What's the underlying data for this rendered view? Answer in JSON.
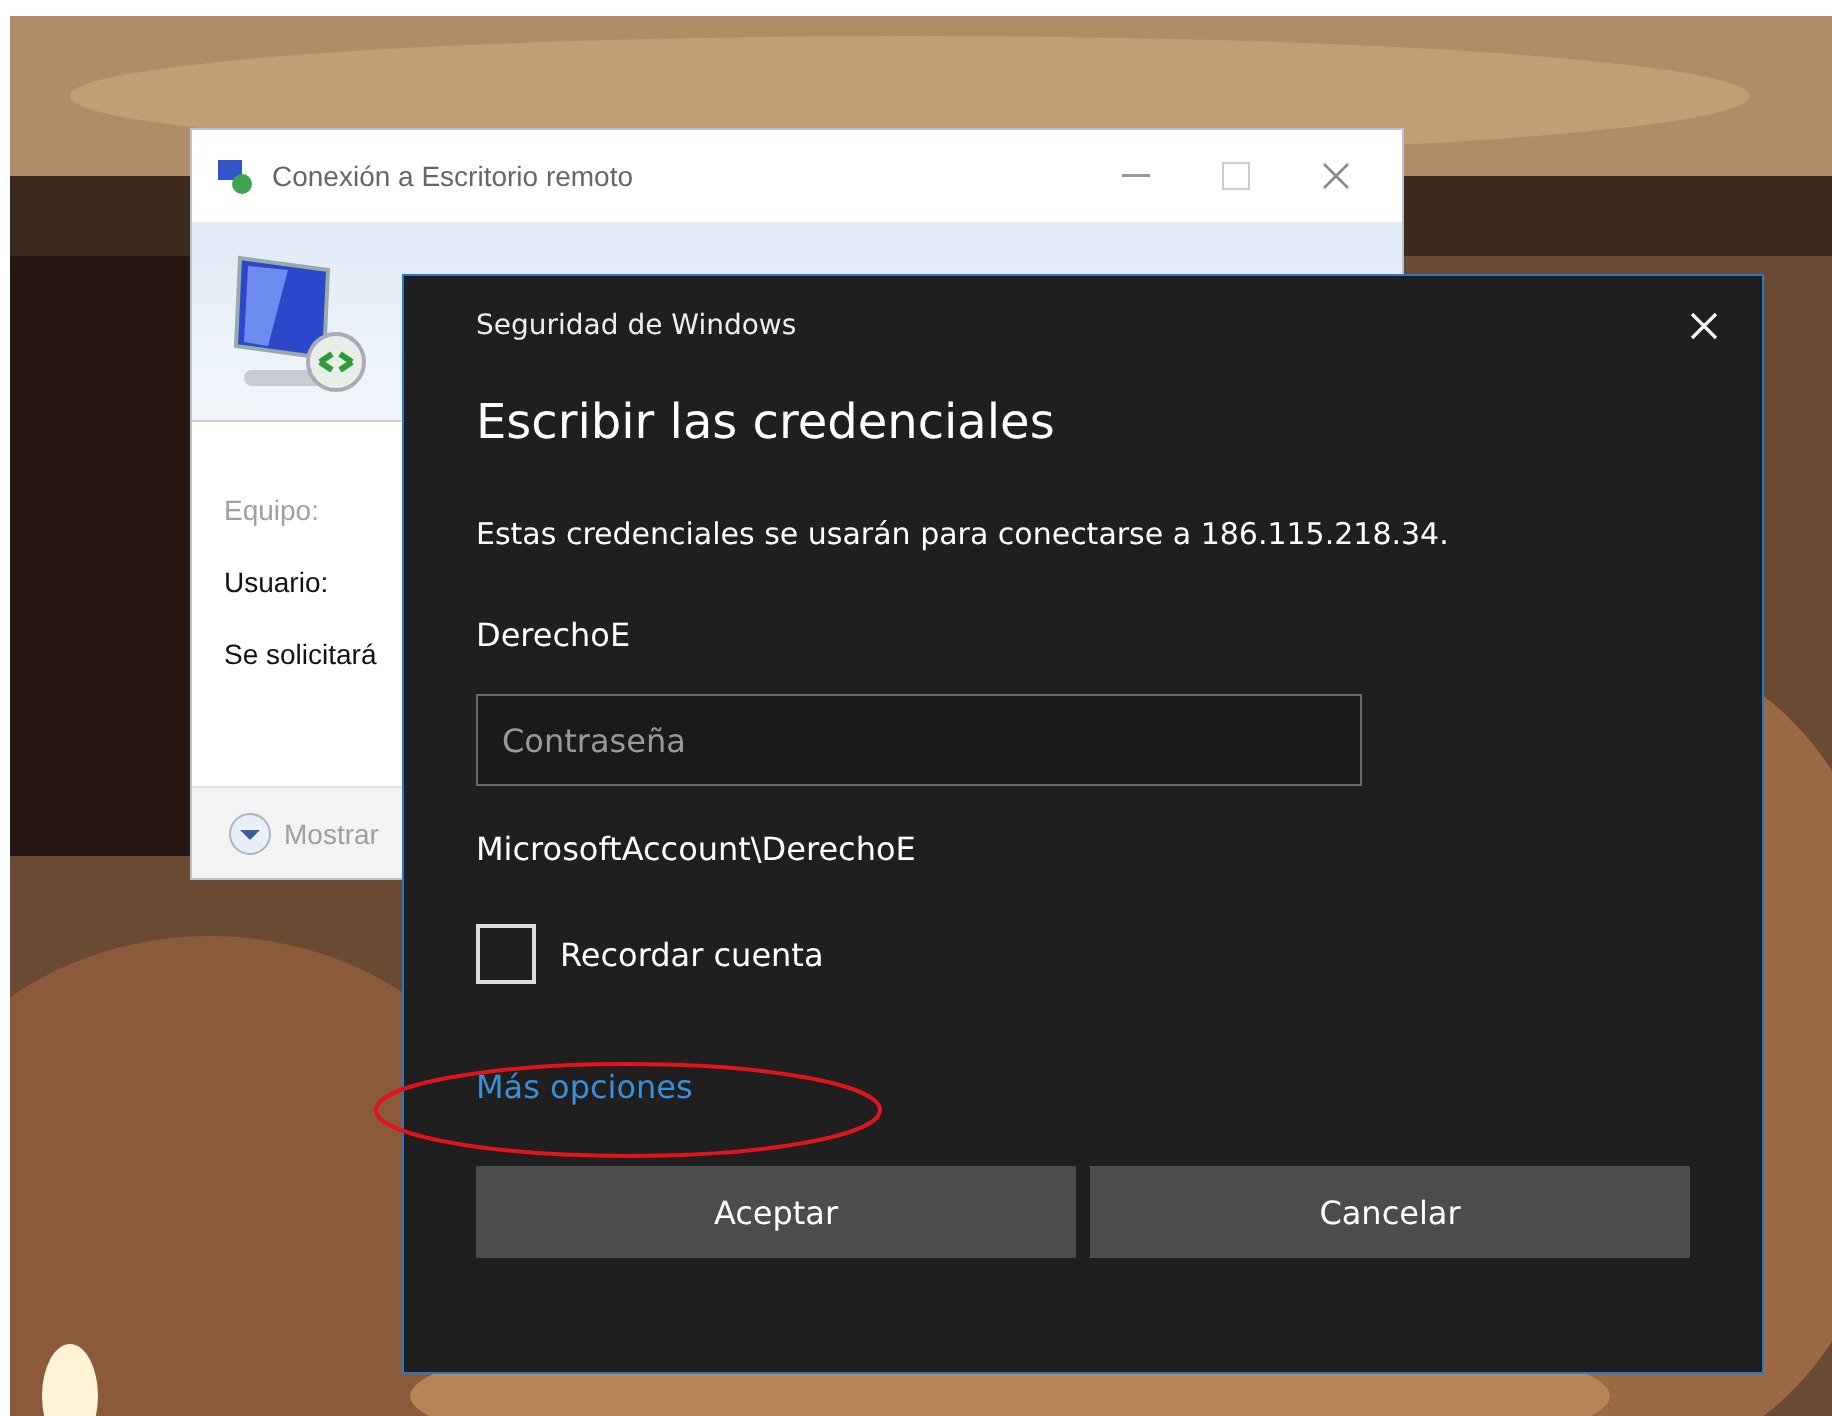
{
  "back_window": {
    "title": "Conexión a Escritorio remoto",
    "fields": [
      {
        "label": "Equipo:",
        "disabled": true
      },
      {
        "label": "Usuario:",
        "disabled": false
      },
      {
        "label": "Se solicitará",
        "disabled": false
      }
    ],
    "options_toggle": {
      "label": "Mostrar",
      "disabled": true
    }
  },
  "dialog": {
    "app_title": "Seguridad de Windows",
    "heading": "Escribir las credenciales",
    "message": "Estas credenciales se usarán para conectarse a 186.115.218.34.",
    "username": "DerechoE",
    "password": {
      "placeholder": "Contraseña"
    },
    "account": "MicrosoftAccount\\DerechoE",
    "remember": {
      "label": "Recordar cuenta",
      "checked": false
    },
    "more_options": "Más opciones",
    "buttons": [
      "Aceptar",
      "Cancelar"
    ]
  }
}
